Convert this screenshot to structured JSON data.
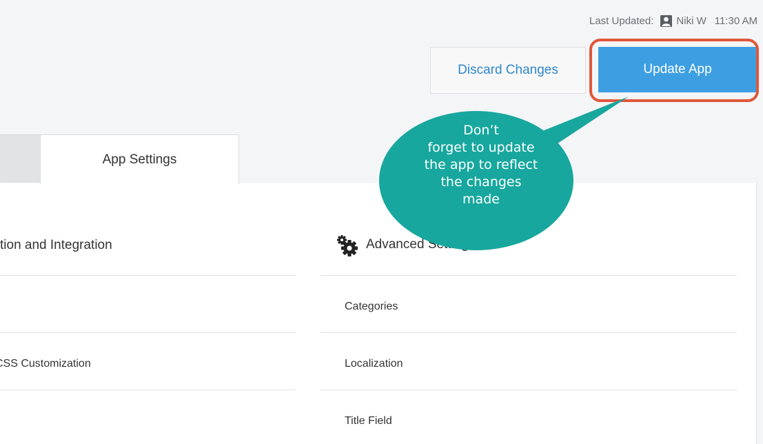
{
  "header": {
    "last_updated_label": "Last Updated:",
    "user_name": "Niki W",
    "time": "11:30 AM",
    "user_icon": "user-icon"
  },
  "actions": {
    "discard_label": "Discard Changes",
    "update_label": "Update App"
  },
  "tabs": [
    {
      "label": ""
    },
    {
      "label": "App Settings"
    }
  ],
  "left_column": {
    "title": "tion and Integration",
    "rows": [
      "",
      "CSS Customization",
      ""
    ]
  },
  "right_column": {
    "icon": "gear-icon",
    "title": "Advanced Settings",
    "rows": [
      "Categories",
      "Localization",
      "Title Field"
    ]
  },
  "callout": {
    "lines": [
      "Don’t",
      "forget to update",
      "the app to reflect",
      "the changes",
      "made"
    ]
  },
  "colors": {
    "accent": "#3d9fe1",
    "link": "#2f86c9",
    "callout": "#17a79e",
    "highlight": "#e0573a"
  }
}
